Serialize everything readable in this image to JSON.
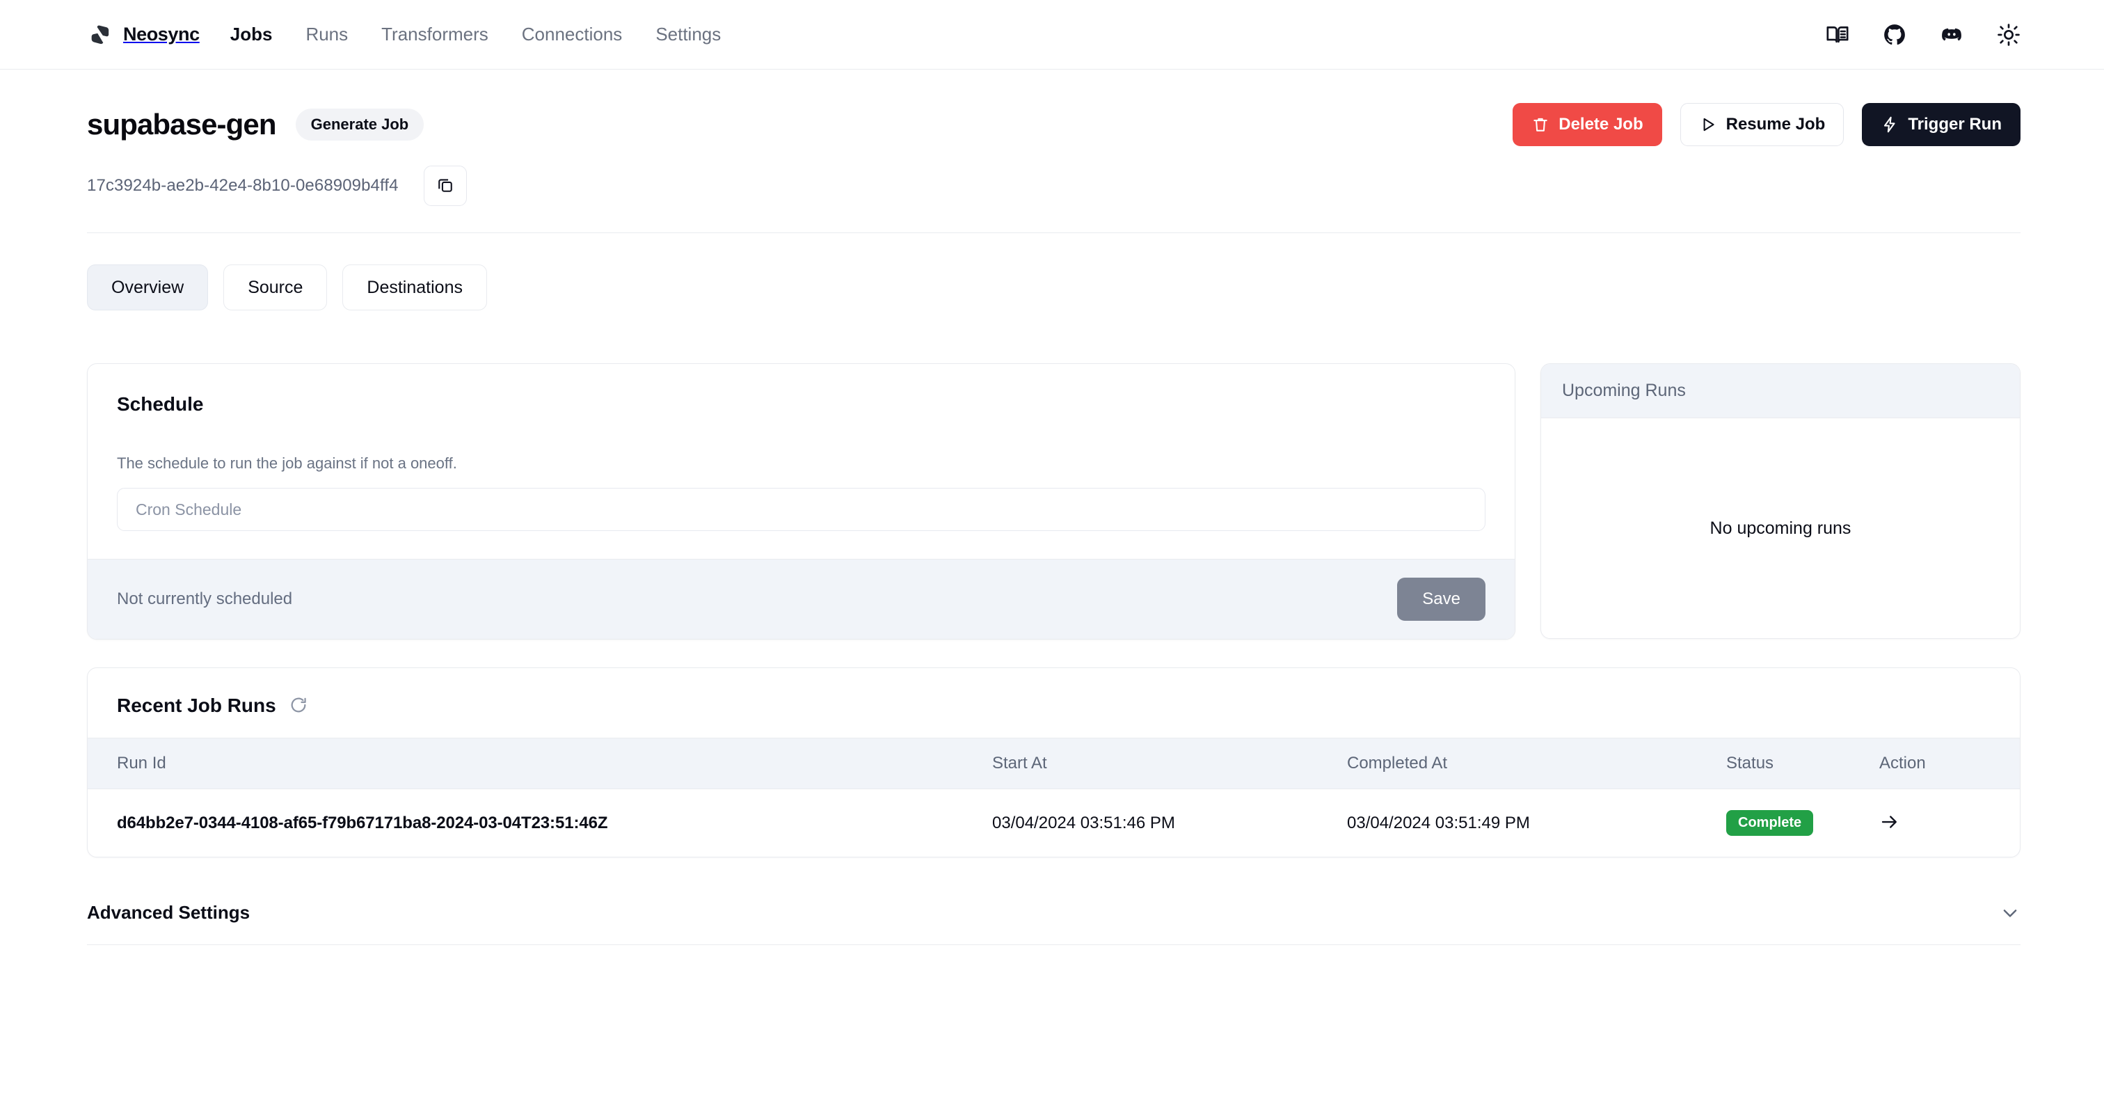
{
  "nav": {
    "brand": "Neosync",
    "brand_logo_icon": "neosync-logo",
    "links": [
      {
        "label": "Jobs",
        "active": true
      },
      {
        "label": "Runs",
        "active": false
      },
      {
        "label": "Transformers",
        "active": false
      },
      {
        "label": "Connections",
        "active": false
      },
      {
        "label": "Settings",
        "active": false
      }
    ],
    "icons": [
      {
        "name": "book-icon"
      },
      {
        "name": "github-icon"
      },
      {
        "name": "discord-icon"
      },
      {
        "name": "sun-icon"
      }
    ]
  },
  "header": {
    "job_title": "supabase-gen",
    "job_type_badge": "Generate Job",
    "job_id": "17c3924b-ae2b-42e4-8b10-0e68909b4ff4",
    "copy_icon": "copy-icon",
    "actions": {
      "delete": "Delete Job",
      "resume": "Resume Job",
      "trigger": "Trigger Run"
    }
  },
  "tabs": [
    {
      "label": "Overview",
      "active": true
    },
    {
      "label": "Source",
      "active": false
    },
    {
      "label": "Destinations",
      "active": false
    }
  ],
  "schedule": {
    "title": "Schedule",
    "description": "The schedule to run the job against if not a oneoff.",
    "cron_value": "",
    "cron_placeholder": "Cron Schedule",
    "status": "Not currently scheduled",
    "save_label": "Save"
  },
  "upcoming_runs": {
    "title": "Upcoming Runs",
    "empty_message": "No upcoming runs"
  },
  "recent_runs": {
    "title": "Recent Job Runs",
    "refresh_icon": "refresh-icon",
    "columns": [
      "Run Id",
      "Start At",
      "Completed At",
      "Status",
      "Action"
    ],
    "rows": [
      {
        "run_id": "d64bb2e7-0344-4108-af65-f79b67171ba8-2024-03-04T23:51:46Z",
        "start_at": "03/04/2024 03:51:46 PM",
        "completed_at": "03/04/2024 03:51:49 PM",
        "status": "Complete",
        "action_icon": "arrow-right-icon"
      }
    ]
  },
  "advanced_settings": {
    "title": "Advanced Settings",
    "chevron_icon": "chevron-down-icon"
  },
  "colors": {
    "danger": "#f04a46",
    "dark": "#111524",
    "success": "#22a046",
    "muted_bg": "#f1f4f9",
    "border": "#e9ebef"
  }
}
